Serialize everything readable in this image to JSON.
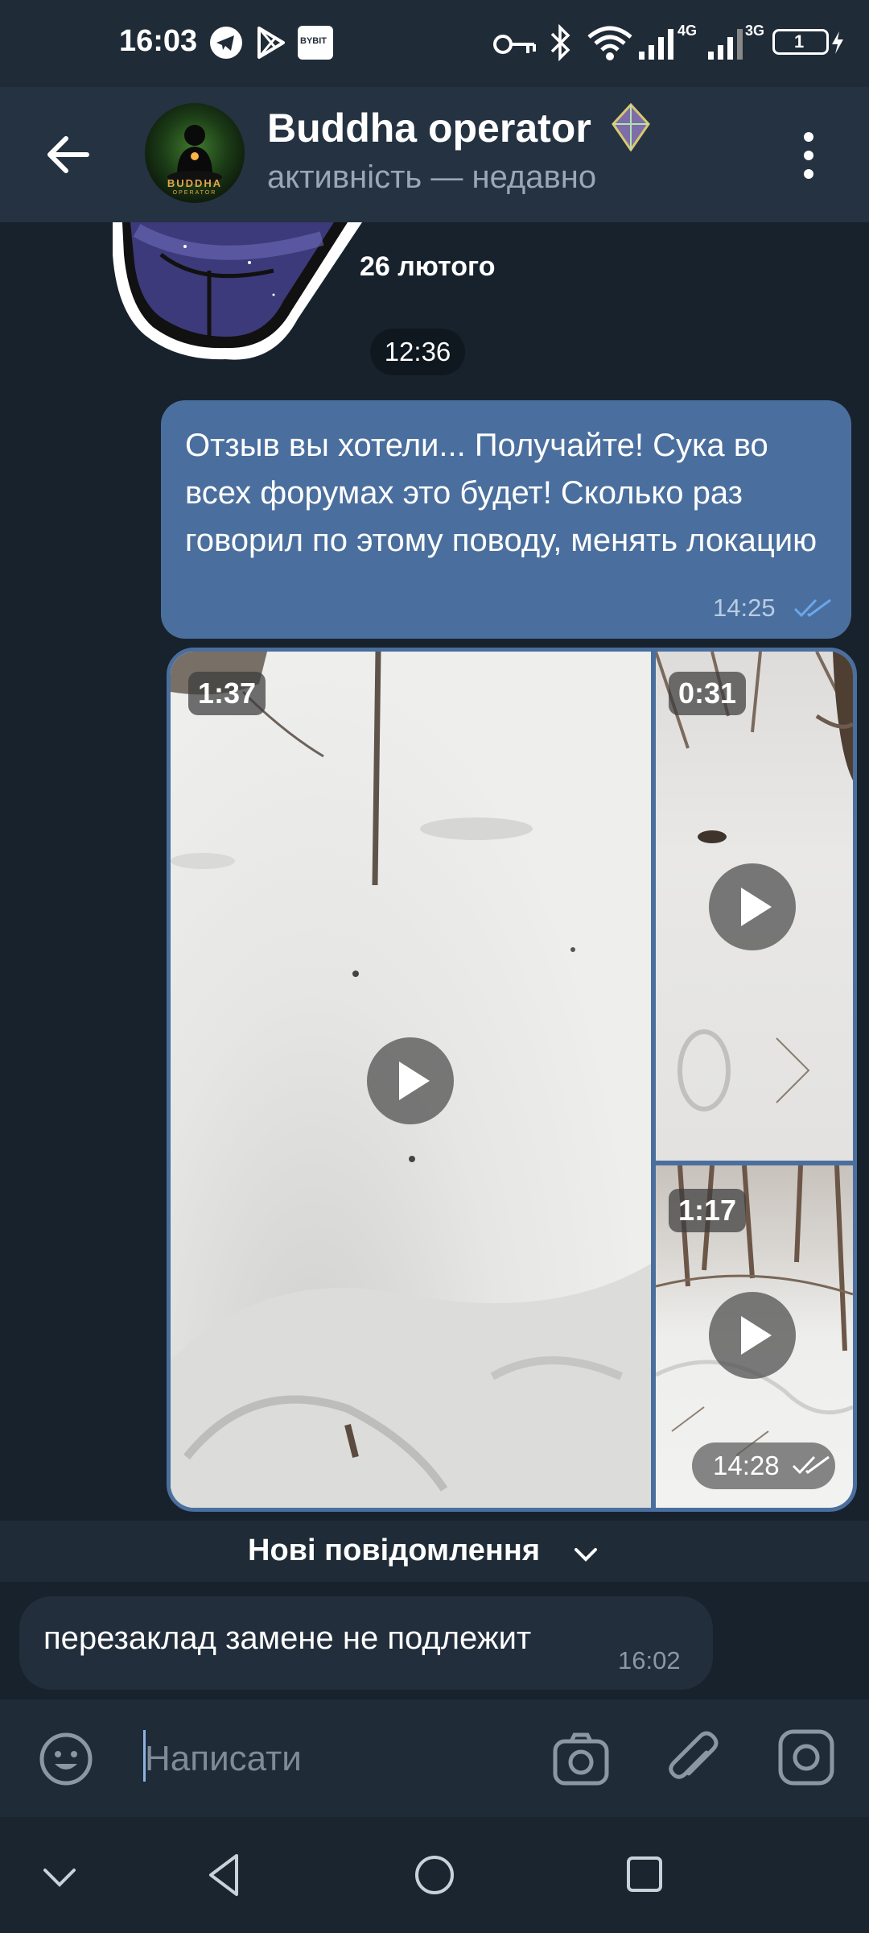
{
  "status_bar": {
    "time": "16:03",
    "icons": [
      "telegram-icon",
      "google-play-icon",
      "bybit-icon",
      "vpn-key-icon",
      "bluetooth-icon",
      "wifi-icon",
      "signal-4g-icon",
      "signal-3g-icon",
      "battery-icon"
    ],
    "bybit_label": "BYBIT",
    "signal_labels": [
      "4G",
      "3G"
    ],
    "battery_level": "1"
  },
  "header": {
    "title": "Buddha operator",
    "status": "активність — недавно",
    "avatar_text": "BUDDHA",
    "avatar_subtext": "OPERATOR"
  },
  "chat": {
    "date_label": "26 лютого",
    "time_label": "12:36",
    "outgoing_message": {
      "text": "Отзыв вы хотели... Получайте! Сука во всех форумах это будет! Сколько раз говорил по этому поводу, менять локацию",
      "time": "14:25"
    },
    "media_group": {
      "videos": [
        {
          "duration": "1:37"
        },
        {
          "duration": "0:31"
        },
        {
          "duration": "1:17"
        }
      ],
      "time": "14:28"
    },
    "new_messages_label": "Нові повідомлення",
    "incoming_message": {
      "text": "перезаклад замене не подлежит",
      "time": "16:02"
    }
  },
  "composer": {
    "placeholder": "Написати"
  },
  "colors": {
    "background": "#18222d",
    "header": "#243242",
    "outgoing_bubble": "#4a6f9e",
    "incoming_bubble": "#222e3b",
    "read_check": "#6aa7ee"
  }
}
